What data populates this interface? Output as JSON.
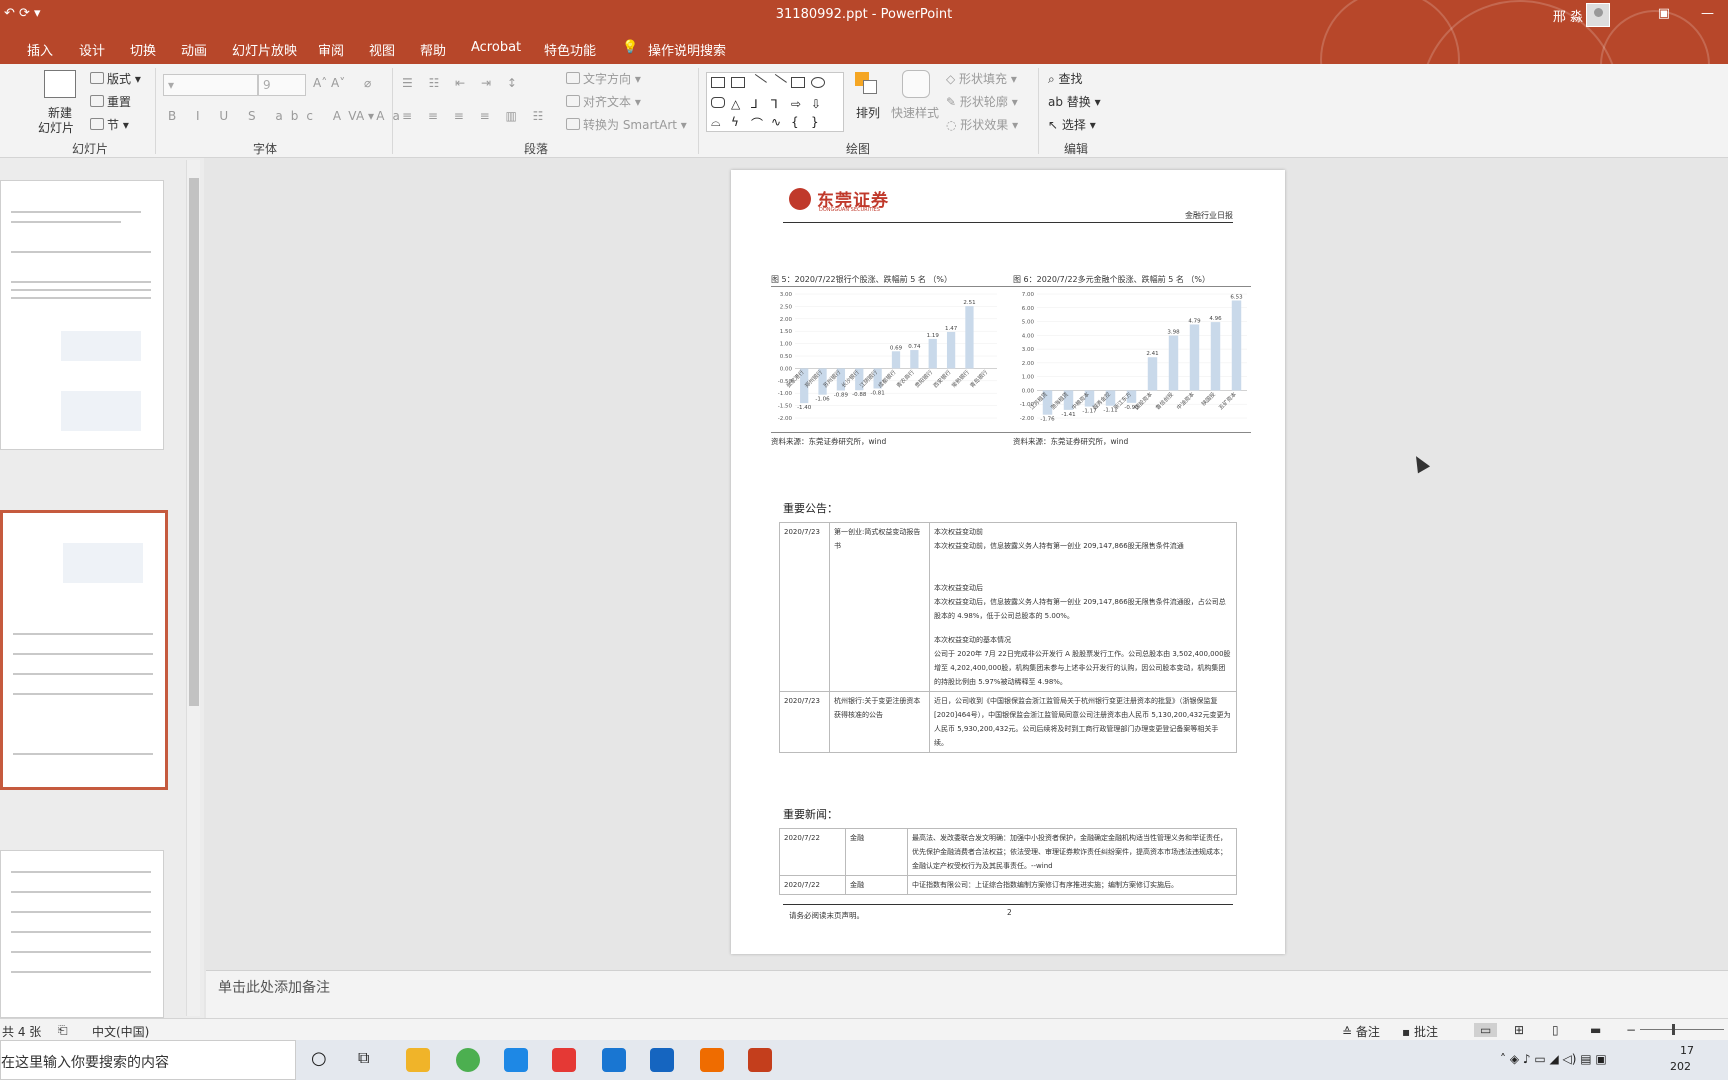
{
  "window": {
    "title": "31180992.ppt  -  PowerPoint",
    "user": "邢 淼"
  },
  "tabs": [
    "插入",
    "设计",
    "切换",
    "动画",
    "幻灯片放映",
    "审阅",
    "视图",
    "帮助",
    "Acrobat",
    "特色功能"
  ],
  "tell_me": "操作说明搜索",
  "ribbon": {
    "slides": {
      "new_slide_line1": "新建",
      "new_slide_line2": "幻灯片",
      "layout": "版式",
      "reset": "重置",
      "section": "节",
      "label": "幻灯片"
    },
    "font": {
      "size": "9",
      "label": "字体"
    },
    "paragraph": {
      "text_direction": "文字方向",
      "align_text": "对齐文本",
      "smartart": "转换为 SmartArt",
      "label": "段落"
    },
    "drawing": {
      "arrange": "排列",
      "quick_styles": "快速样式",
      "shape_fill": "形状填充",
      "shape_outline": "形状轮廓",
      "shape_effects": "形状效果",
      "label": "绘图"
    },
    "editing": {
      "find": "查找",
      "replace": "替换",
      "select": "选择",
      "label": "编辑"
    }
  },
  "slide": {
    "brand_cn": "东莞证券",
    "brand_en": "DONGGUAN SECURITIES",
    "header_right": "金融行业日报",
    "fig5_title": "图 5：2020/7/22银行个股涨、跌幅前 5 名 （%）",
    "fig6_title": "图 6：2020/7/22多元金融个股涨、跌幅前 5 名 （%）",
    "fig5_source": "资料来源：东莞证券研究所，wind",
    "fig6_source": "资料来源：东莞证券研究所，wind",
    "announcements_title": "重要公告：",
    "announcements": [
      {
        "date": "2020/7/23",
        "subject": "第一创业:简式权益变动报告书",
        "body": [
          "本次权益变动前",
          "本次权益变动前，信息披露义务人持有第一创业 209,147,866股无限售条件流通",
          "",
          "本次权益变动后",
          "本次权益变动后，信息披露义务人持有第一创业 209,147,866股无限售条件流通股，占公司总股本的 4.98%，低于公司总股本的 5.00%。",
          "",
          "本次权益变动的基本情况",
          "公司于 2020年 7月 22日完成非公开发行 A 股股票发行工作。公司总股本由 3,502,400,000股增至 4,202,400,000股，机构集团未参与上述非公开发行的认购，因公司股本变动，机构集团的持股比例由 5.97%被动稀释至 4.98%。"
        ]
      },
      {
        "date": "2020/7/23",
        "subject": "杭州银行:关于变更注册资本获得核准的公告",
        "body": [
          "近日，公司收到《中国银保监会浙江监管局关于杭州银行变更注册资本的批复》（浙银保监复[2020]464号），中国银保监会浙江监管局同意公司注册资本由人民币 5,130,200,432元变更为人民币 5,930,200,432元。公司后续将及时到工商行政管理部门办理变更登记备案等相关手续。"
        ]
      }
    ],
    "news_title": "重要新闻：",
    "news": [
      {
        "date": "2020/7/22",
        "category": "金融",
        "body": "最高法、发改委联合发文明确：加强中小投资者保护，金融确定金融机构适当性管理义务和举证责任，优先保护金融消费者合法权益；依法受理、审理证券欺诈责任纠纷案件，提高资本市场违法违规成本；金融认定产权受权行为及其民事责任。--wind"
      },
      {
        "date": "2020/7/22",
        "category": "金融",
        "body": "中证指数有限公司：上证综合指数编制方案修订有序推进实施；编制方案修订实施后。"
      }
    ],
    "footer_left": "请务必阅读末页声明。",
    "page_number": "2"
  },
  "chart_data": [
    {
      "type": "bar",
      "title": "图 5：2020/7/22银行个股涨、跌幅前 5 名 （%）",
      "categories": [
        "张家港行",
        "郑州银行",
        "苏州银行",
        "长沙银行",
        "江阴银行",
        "成都银行",
        "青农商行",
        "贵阳银行",
        "西安银行",
        "常熟银行",
        "青岛银行"
      ],
      "values": [
        -1.4,
        -1.06,
        -0.89,
        -0.88,
        -0.81,
        0.69,
        0.74,
        1.19,
        1.47,
        2.51
      ],
      "ylim": [
        -2.0,
        3.0
      ],
      "yticks": [
        "3.00",
        "2.50",
        "2.00",
        "1.50",
        "1.00",
        "0.50",
        "0.00",
        "-0.50",
        "-1.00",
        "-1.50",
        "-2.00"
      ],
      "color": "#c9d9ea"
    },
    {
      "type": "bar",
      "title": "图 6：2020/7/22多元金融个股涨、跌幅前 5 名 （%）",
      "categories": [
        "江苏租赁",
        "渤海租赁",
        "中粮资本",
        "越秀金控",
        "浙江东方",
        "国投资本",
        "鲁信创投",
        "中油资本",
        "陕国投",
        "五矿资本"
      ],
      "values": [
        -1.76,
        -1.41,
        -1.17,
        -1.11,
        -0.9,
        2.41,
        3.98,
        4.79,
        4.96,
        6.53
      ],
      "ylim": [
        -2.0,
        7.0
      ],
      "yticks": [
        "7.00",
        "6.00",
        "5.00",
        "4.00",
        "3.00",
        "2.00",
        "1.00",
        "0.00",
        "-1.00",
        "-2.00"
      ],
      "color": "#c9d9ea"
    }
  ],
  "notes_placeholder": "单击此处添加备注",
  "status": {
    "slide_count": "共 4 张",
    "language": "中文(中国)",
    "notes": "备注",
    "comments": "批注"
  },
  "taskbar": {
    "search_text": "在这里输入你要搜索的内容",
    "clock_time": "17",
    "clock_year": "202"
  },
  "colors": {
    "accent": "#b7472a",
    "bar": "#c9d9ea"
  }
}
